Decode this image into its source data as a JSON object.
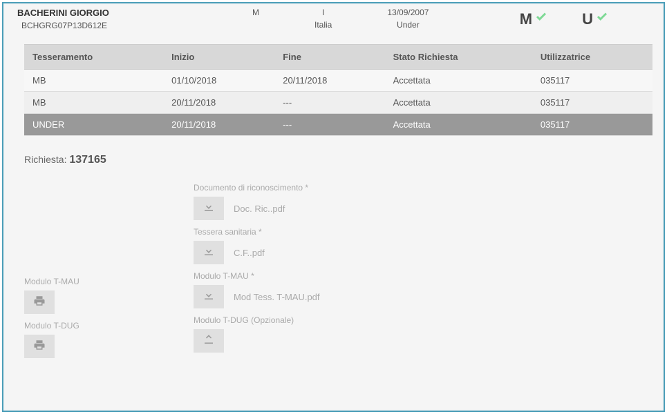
{
  "person": {
    "name": "BACHERINI GIORGIO",
    "code": "BCHGRG07P13D612E"
  },
  "gender": "M",
  "country_short": "I",
  "country": "Italia",
  "birthdate": "13/09/2007",
  "category": "Under",
  "status": {
    "m": "M",
    "u": "U"
  },
  "table": {
    "headers": {
      "tess": "Tesseramento",
      "inizio": "Inizio",
      "fine": "Fine",
      "stato": "Stato Richiesta",
      "util": "Utilizzatrice"
    },
    "rows": [
      {
        "tess": "MB",
        "inizio": "01/10/2018",
        "fine": "20/11/2018",
        "stato": "Accettata",
        "util": "035117"
      },
      {
        "tess": "MB",
        "inizio": "20/11/2018",
        "fine": "---",
        "stato": "Accettata",
        "util": "035117"
      },
      {
        "tess": "UNDER",
        "inizio": "20/11/2018",
        "fine": "---",
        "stato": "Accettata",
        "util": "035117"
      }
    ]
  },
  "request": {
    "label": "Richiesta:",
    "number": "137165"
  },
  "left": {
    "mau_label": "Modulo T-MAU",
    "dug_label": "Modulo T-DUG"
  },
  "docs": {
    "ric_label": "Documento di riconoscimento *",
    "ric_file": "Doc. Ric..pdf",
    "tess_label": "Tessera sanitaria *",
    "tess_file": "C.F..pdf",
    "mau_label": "Modulo T-MAU *",
    "mau_file": "Mod Tess. T-MAU.pdf",
    "dug_label": "Modulo T-DUG (Opzionale)"
  }
}
